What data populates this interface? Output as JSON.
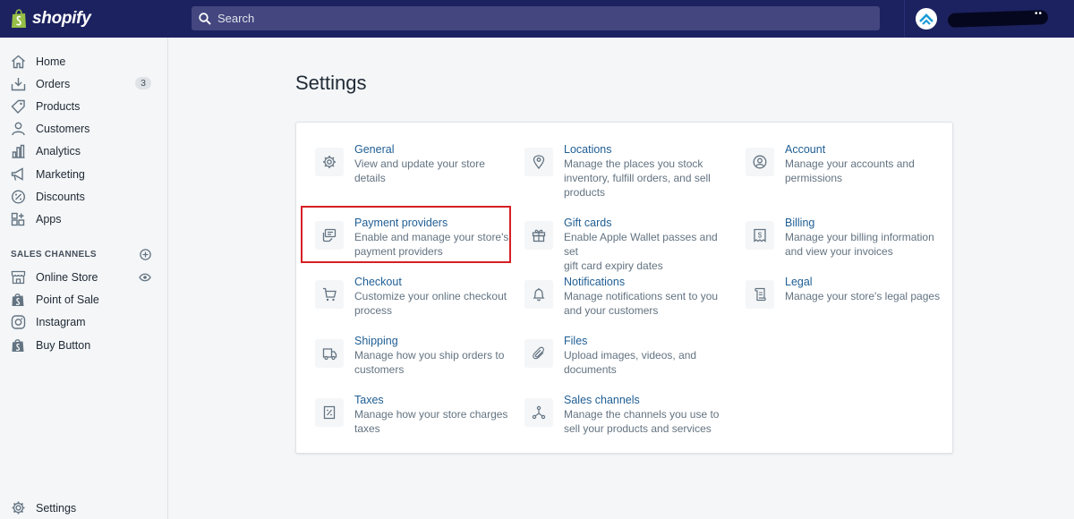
{
  "topbar": {
    "brand": "shopify",
    "search_placeholder": "Search"
  },
  "sidebar": {
    "items": [
      {
        "label": "Home",
        "icon": "home-icon"
      },
      {
        "label": "Orders",
        "icon": "orders-icon",
        "badge": "3"
      },
      {
        "label": "Products",
        "icon": "tag-icon"
      },
      {
        "label": "Customers",
        "icon": "person-icon"
      },
      {
        "label": "Analytics",
        "icon": "bar-chart-icon"
      },
      {
        "label": "Marketing",
        "icon": "megaphone-icon"
      },
      {
        "label": "Discounts",
        "icon": "discount-icon"
      },
      {
        "label": "Apps",
        "icon": "apps-icon"
      }
    ],
    "sales_channels_title": "SALES CHANNELS",
    "channels": [
      {
        "label": "Online Store",
        "icon": "store-icon"
      },
      {
        "label": "Point of Sale",
        "icon": "pos-bag-icon"
      },
      {
        "label": "Instagram",
        "icon": "instagram-icon"
      },
      {
        "label": "Buy Button",
        "icon": "buy-bag-icon"
      }
    ],
    "settings_label": "Settings"
  },
  "main": {
    "page_title": "Settings",
    "tiles": [
      {
        "title": "General",
        "desc": [
          "View and update your store",
          "details"
        ],
        "icon": "gear-icon"
      },
      {
        "title": "Locations",
        "desc": [
          "Manage the places you stock",
          "inventory, fulfill orders, and sell",
          "products"
        ],
        "icon": "location-pin-icon"
      },
      {
        "title": "Account",
        "desc": [
          "Manage your accounts and",
          "permissions"
        ],
        "icon": "account-icon"
      },
      {
        "title": "Payment providers",
        "desc": [
          "Enable and manage your store's",
          "payment providers"
        ],
        "icon": "payment-icon"
      },
      {
        "title": "Gift cards",
        "desc": [
          "Enable Apple Wallet passes and set",
          "gift card expiry dates"
        ],
        "icon": "gift-icon"
      },
      {
        "title": "Billing",
        "desc": [
          "Manage your billing information",
          "and view your invoices"
        ],
        "icon": "billing-icon"
      },
      {
        "title": "Checkout",
        "desc": [
          "Customize your online checkout",
          "process"
        ],
        "icon": "cart-icon"
      },
      {
        "title": "Notifications",
        "desc": [
          "Manage notifications sent to you",
          "and your customers"
        ],
        "icon": "bell-icon"
      },
      {
        "title": "Legal",
        "desc": [
          "Manage your store's legal pages"
        ],
        "icon": "legal-icon"
      },
      {
        "title": "Shipping",
        "desc": [
          "Manage how you ship orders to",
          "customers"
        ],
        "icon": "truck-icon"
      },
      {
        "title": "Files",
        "desc": [
          "Upload images, videos, and",
          "documents"
        ],
        "icon": "paperclip-icon"
      },
      {
        "title": "Taxes",
        "desc": [
          "Manage how your store charges",
          "taxes"
        ],
        "icon": "tax-icon"
      },
      {
        "title": "Sales channels",
        "desc": [
          "Manage the channels you use to",
          "sell your products and services"
        ],
        "icon": "sales-channels-icon"
      }
    ]
  },
  "colors": {
    "topbar": "#1c2260",
    "link": "#1f5e94",
    "highlight": "#d51f24"
  }
}
